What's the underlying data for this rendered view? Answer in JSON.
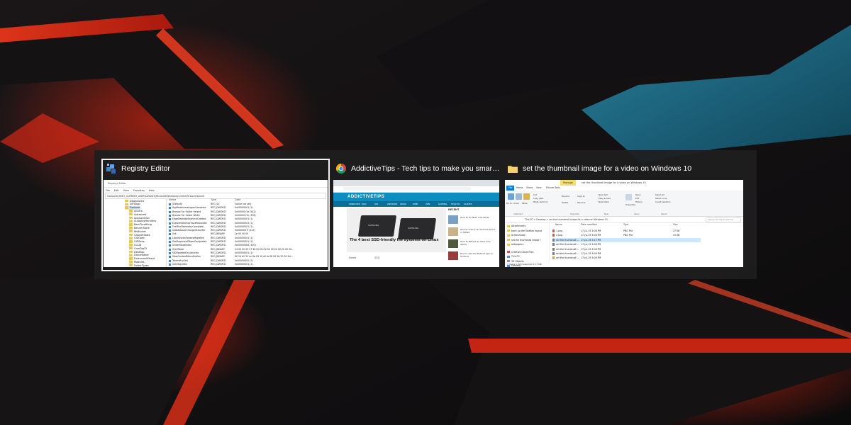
{
  "switcher": {
    "windows": [
      {
        "title": "Registry Editor",
        "icon": "registry-editor-icon",
        "selected": true
      },
      {
        "title": "AddictiveTips - Tech tips to make you smarter - Google Ch...",
        "icon": "chrome-icon",
        "selected": false
      },
      {
        "title": "set the thumbnail image for a video on Windows 10",
        "icon": "folder-icon",
        "selected": false
      }
    ]
  },
  "registry": {
    "title": "Registry Editor",
    "menu": [
      "File",
      "Edit",
      "View",
      "Favorites",
      "Help"
    ],
    "address": "Computer\\HKEY_CURRENT_USER\\Software\\Microsoft\\Windows\\CurrentVersion\\Explorer",
    "tree": [
      "Diagnostics",
      "DIFxApp",
      "Explorer",
      "Accent",
      "Advanced",
      "AppContract",
      "AutoplayHandlers",
      "BamThrottling",
      "BannerStore",
      "BitBucket",
      "CabinetState",
      "CIDOpen",
      "CIDSave",
      "CLSID",
      "ComDlg32",
      "Desktop",
      "Discardable",
      "ExtensionWizard",
      "Modules",
      "FolderTypes"
    ],
    "columns": [
      "Name",
      "Type",
      "Data"
    ],
    "rows": [
      [
        "(Default)",
        "REG_SZ",
        "(value not set)"
      ],
      [
        "AppReadinessLogonComplete",
        "REG_DWORD",
        "0x00000001 (1)"
      ],
      [
        "Browse For Folder Height",
        "REG_DWORD",
        "0x0000021e (542)"
      ],
      [
        "Browse For Folder Width",
        "REG_DWORD",
        "0x0000017e (378)"
      ],
      [
        "EdgeDesktopShortcutCreated",
        "REG_DWORD",
        "0x00000001 (1)"
      ],
      [
        "ExplorerStartupTraceRecorded",
        "REG_DWORD",
        "0x00000001 (1)"
      ],
      [
        "FirstRunTelemetryComplete",
        "REG_DWORD",
        "0x00000001 (1)"
      ],
      [
        "GlobalAssocChangedCounter",
        "REG_DWORD",
        "0x0000007f (127)"
      ],
      [
        "link",
        "REG_BINARY",
        "1e 00 00 00"
      ],
      [
        "LocalKnownFoldersMigrated",
        "REG_DWORD",
        "0x00000001 (1)"
      ],
      [
        "PostAppInstallTasksCompleted",
        "REG_DWORD",
        "0x00000001 (1)"
      ],
      [
        "ScreenShotIndex",
        "REG_DWORD",
        "0x00000064 (100)"
      ],
      [
        "ShellState",
        "REG_BINARY",
        "24 00 00 00 37 28 00 00 00 00 00 00 00 00 00 00..."
      ],
      [
        "SIDUpdatedOnLibraries",
        "REG_DWORD",
        "0x00000001 (1)"
      ],
      [
        "SlowContextMenuEntries",
        "REG_BINARY",
        "60 24 b2 21 ec 6a 09 10 a2 fa 08 00 2b 30 30 9d..."
      ],
      [
        "TelemetrySalt",
        "REG_DWORD",
        "0x00000002 (2)"
      ],
      [
        "UserSignedIn",
        "REG_DWORD",
        "0x00000001 (1)"
      ]
    ]
  },
  "chrome": {
    "logo": "ADDICTIVETIPS",
    "nav": [
      "WINDOWS",
      "MAC",
      "IOS",
      "ANDROID",
      "LINUX",
      "WEB",
      "VPN",
      "GAMING",
      "HOW-TO",
      "GUIDES"
    ],
    "headline": "The 4 best SSD-friendly file systems on Linux",
    "ssd_label": "SAMSUNG",
    "side_label": "RECENT",
    "side_items": [
      "How To Fix Moto Lost Mode",
      "How to Unlock an Android Phone or Tablet",
      "How To Refund An Xbox One Game",
      "How to Set The Default App on Android"
    ],
    "bottom_labels": [
      "Home",
      "Windows",
      "SSD"
    ]
  },
  "explorer": {
    "title": "set the thumbnail image for a video on Windows 10",
    "manage": "Manage",
    "tabs": [
      "File",
      "Home",
      "Share",
      "View",
      "Picture Tools"
    ],
    "ribbon": {
      "clipboard": [
        "Pin to Quick access",
        "Copy",
        "Paste"
      ],
      "clip_small": [
        "Cut",
        "Copy path",
        "Paste shortcut"
      ],
      "organize": [
        "Move to",
        "Copy to",
        "Delete",
        "Rename"
      ],
      "new": [
        "New item",
        "Easy access",
        "New folder"
      ],
      "open": [
        "Properties",
        "Open",
        "Edit",
        "History"
      ],
      "select": [
        "Select all",
        "Select none",
        "Invert selection"
      ],
      "groups": [
        "Clipboard",
        "Organize",
        "New",
        "Open",
        "Select"
      ]
    },
    "address": "This PC  >  Desktop  >  set the thumbnail image for a video on Windows 10",
    "search": "Search set the thumbnail...",
    "nav": [
      "Attachments",
      "back up the Taskbar layout",
      "Screenshots",
      "set the thumbnail image f",
      "wallpapers",
      "Creative Cloud Files",
      "This PC",
      "3D Objects",
      "Desktop"
    ],
    "columns": [
      "Name",
      "Date modified",
      "Type",
      "Size"
    ],
    "files": [
      [
        "1.png",
        "17-Jul-19 5:08 PM",
        "PNG File",
        "27 KB"
      ],
      [
        "2.png",
        "17-Jul-19 5:08 PM",
        "PNG File",
        "31 KB"
      ],
      [
        "set the thumbnail i...",
        "17-Jul-19 5:13 PM",
        "",
        ""
      ],
      [
        "set the thumbnail i...",
        "17-Jul-19 5:08 PM",
        "",
        ""
      ],
      [
        "set the thumbnail i...",
        "17-Jul-19 5:08 PM",
        "",
        ""
      ],
      [
        "set the thumbnail i...",
        "17-Jul-19 5:08 PM",
        "",
        ""
      ],
      [
        "set the thumbnail i...",
        "17-Jul-19 5:08 PM",
        "",
        ""
      ]
    ],
    "status": "7 items   1 item selected   8.27 MB"
  },
  "colors": {
    "switcher_bg": "#1e1e1e",
    "selected_outline": "#f2f2f2",
    "addictivetips_blue": "#0e8dc0",
    "explorer_file_tab": "#1979ca",
    "folder_yellow": "#e9c55b"
  }
}
